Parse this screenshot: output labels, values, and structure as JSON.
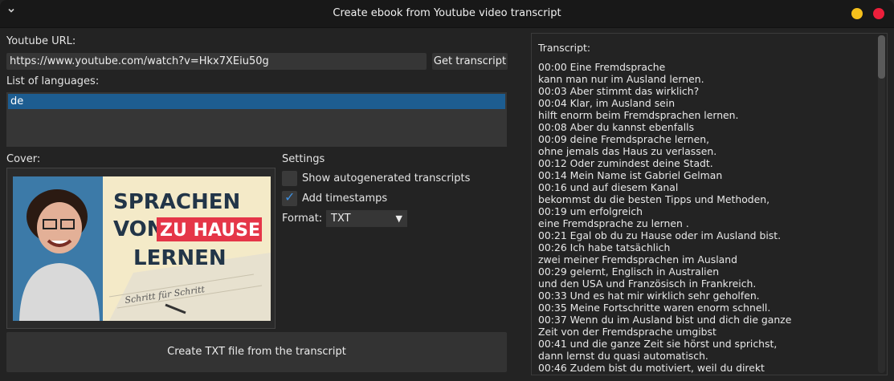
{
  "window": {
    "title": "Create ebook from Youtube video transcript",
    "menu_icon": "chevron-down-icon",
    "minimize_color": "#f5c01c",
    "close_color": "#ec1f3b"
  },
  "url": {
    "label": "Youtube URL:",
    "value": "https://www.youtube.com/watch?v=Hkx7XEiu50g",
    "get_button": "Get transcript"
  },
  "languages": {
    "label": "List of languages:",
    "items": [
      "de"
    ],
    "selected_color": "#1d5d91"
  },
  "cover": {
    "label": "Cover:",
    "thumbnail": {
      "line1": "SPRACHEN",
      "line2a": "VON",
      "line2b": "ZU HAUSE",
      "line3": "LERNEN",
      "note": "Schritt für Schritt"
    }
  },
  "settings": {
    "label": "Settings",
    "autogenerated": {
      "label": "Show autogenerated transcripts",
      "checked": false
    },
    "timestamps": {
      "label": "Add timestamps",
      "checked": true
    },
    "format_label": "Format:",
    "format_value": "TXT"
  },
  "create_button": "Create TXT file from the transcript",
  "transcript": {
    "heading": "Transcript:",
    "lines": [
      "00:00 Eine Fremdsprache",
      "kann man nur im Ausland lernen.",
      "00:03 Aber stimmt das wirklich?",
      "00:04 Klar, im Ausland sein",
      "hilft enorm beim Fremdsprachen lernen.",
      "00:08 Aber du kannst ebenfalls",
      "00:09 deine Fremdsprache lernen,",
      "ohne jemals das Haus zu verlassen.",
      "00:12 Oder zumindest deine Stadt.",
      "00:14 Mein Name ist Gabriel Gelman",
      "00:16 und auf diesem Kanal",
      "bekommst du die besten Tipps und Methoden,",
      "00:19 um erfolgreich",
      "eine Fremdsprache zu lernen .",
      "00:21 Egal ob du zu Hause oder im Ausland bist.",
      "00:26 Ich habe tatsächlich",
      "zwei meiner Fremdsprachen im Ausland",
      "00:29 gelernt, Englisch in Australien",
      "und den USA und Französisch in Frankreich.",
      "00:33 Und es hat mir wirklich sehr geholfen.",
      "00:35 Meine Fortschritte waren enorm schnell.",
      "00:37 Wenn du im Ausland bist und dich die ganze",
      "Zeit von der Fremdsprache umgibst",
      "00:41 und die ganze Zeit sie hörst und sprichst,",
      "dann lernst du quasi automatisch.",
      "00:46 Zudem bist du motiviert, weil du direkt"
    ]
  }
}
